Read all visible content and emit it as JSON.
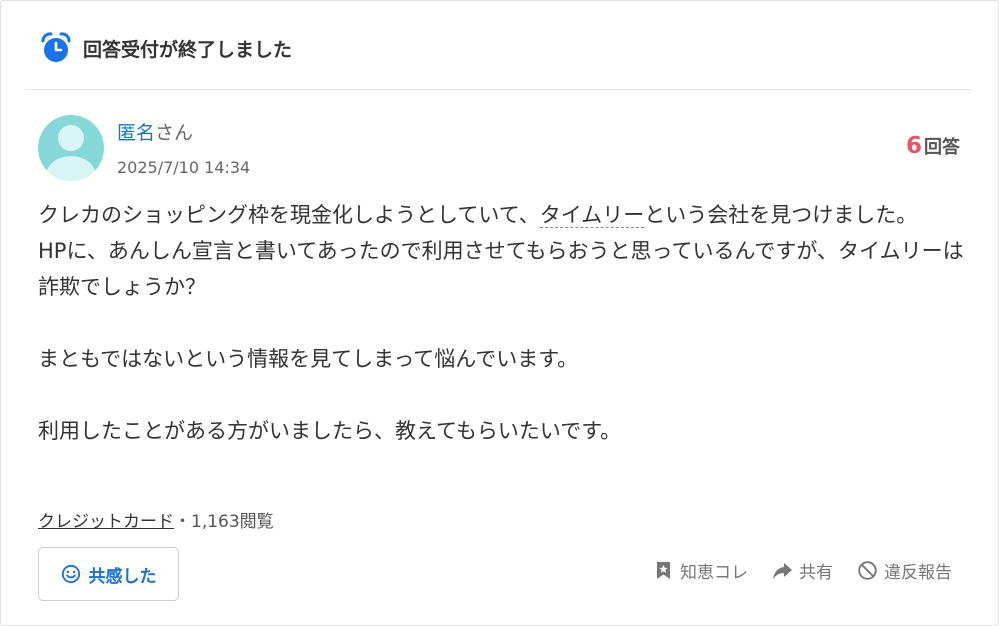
{
  "banner": {
    "text": "回答受付が終了しました",
    "icon": "alarm-clock-icon",
    "icon_color": "#1a73e8"
  },
  "question": {
    "author_name": "匿名",
    "author_suffix": "さん",
    "timestamp": "2025/7/10 14:34",
    "answer_count": "6",
    "answer_label": "回答",
    "body": {
      "line1_a": "クレカのショッピング枠を現金化しようとしていて、",
      "line1_link": "タイムリー",
      "line1_b": "という会社を見つけました。",
      "line2": "HPに、あんしん宣言と書いてあったので利用させてもらおうと思っているんですが、タイムリーは詐欺でしょうか？",
      "line3": "まともではないという情報を見てしまって悩んでいます。",
      "line4": "利用したことがある方がいましたら、教えてもらいたいです。"
    },
    "category": "クレジットカード",
    "separator": "・",
    "views": "1,163閲覧"
  },
  "actions": {
    "empathy_label": "共感した",
    "save_label": "知恵コレ",
    "share_label": "共有",
    "report_label": "違反報告"
  },
  "colors": {
    "link": "#1a73c6",
    "answer_count": "#e8526a",
    "avatar": "#86d8d8"
  }
}
